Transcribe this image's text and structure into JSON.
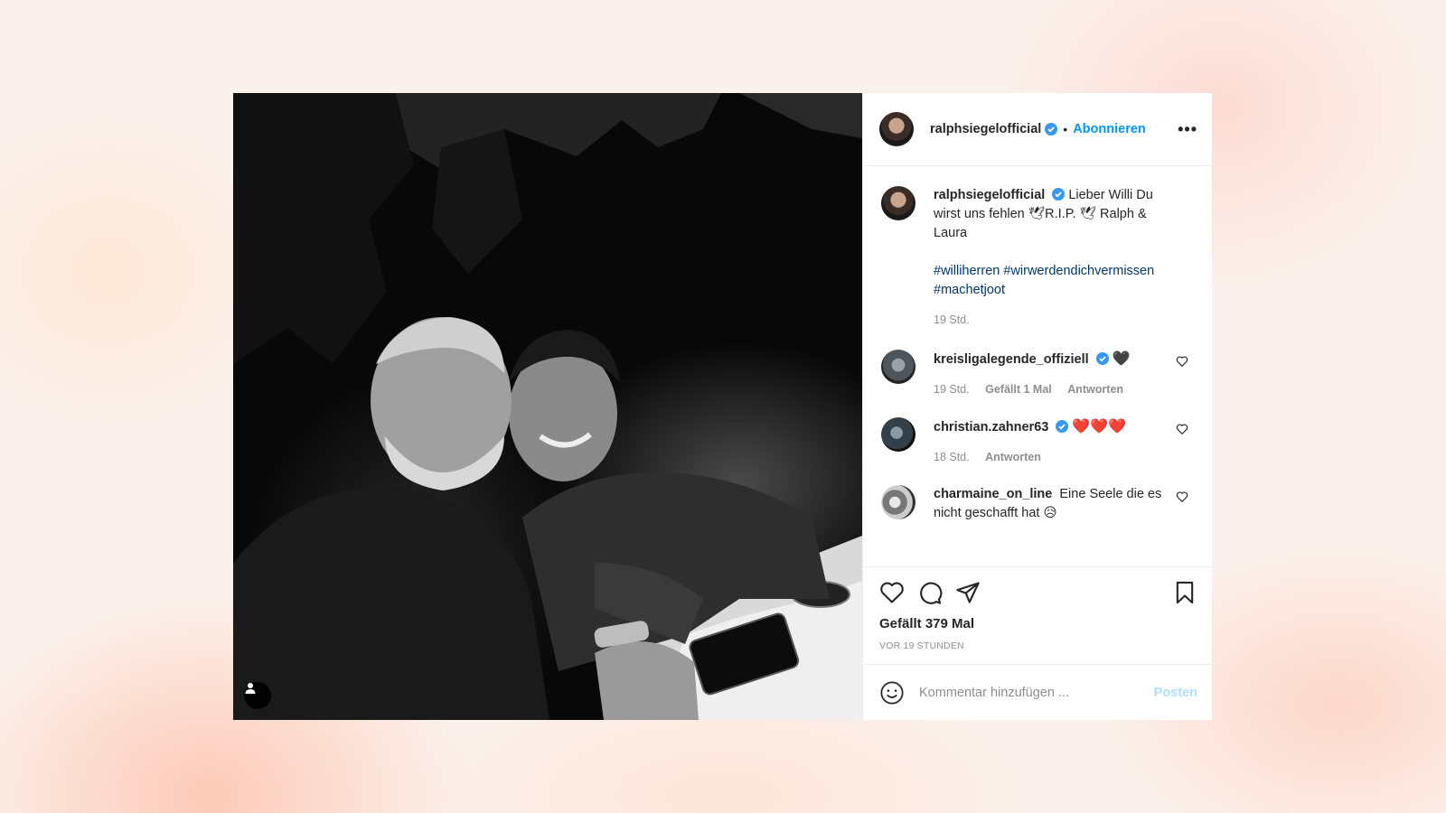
{
  "post": {
    "username": "ralphsiegelofficial",
    "follow_label": "Abonnieren",
    "separator": "•",
    "more_label": "•••",
    "caption_text": "Lieber Willi Du wirst uns fehlen 🕊R.I.P. 🕊 Ralph & Laura",
    "hashtags": [
      "#williherren",
      "#wirwerdendichvermissen",
      "#machetjoot"
    ],
    "caption_time": "19 Std.",
    "likes_label": "Gefällt 379 Mal",
    "timestamp": "VOR 19 STUNDEN",
    "comment_placeholder": "Kommentar hinzufügen ...",
    "post_button": "Posten"
  },
  "comments": [
    {
      "username": "kreisligalegende_offiziell",
      "verified": true,
      "text": "🖤",
      "time": "19 Std.",
      "likes": "Gefällt 1 Mal",
      "reply": "Antworten"
    },
    {
      "username": "christian.zahner63",
      "verified": true,
      "text": "❤️❤️❤️",
      "time": "18 Std.",
      "likes": "",
      "reply": "Antworten"
    },
    {
      "username": "charmaine_on_line",
      "verified": false,
      "text": "Eine Seele die es nicht geschafft hat 😥",
      "time": "",
      "likes": "",
      "reply": ""
    }
  ],
  "icons": {
    "verified": "verified-badge-icon",
    "like": "heart-icon",
    "comment": "comment-bubble-icon",
    "share": "paper-plane-icon",
    "save": "bookmark-icon",
    "emoji": "smiley-icon",
    "tag": "user-tag-icon"
  },
  "colors": {
    "accent": "#0095f6",
    "hashtag": "#00376b",
    "muted": "#8e8e8e",
    "post_disabled": "#b2dffc"
  }
}
